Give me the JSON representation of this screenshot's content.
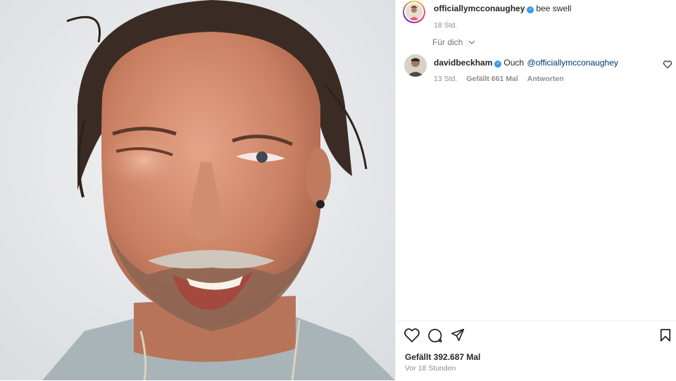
{
  "post": {
    "author": "officiallymcconaughey",
    "caption": "bee swell",
    "time": "18 Std."
  },
  "filter": {
    "label": "Für dich",
    "icon": "chevron-down-icon"
  },
  "comment": {
    "author": "davidbeckham",
    "text": "Ouch",
    "mention": "@officiallymcconaughey",
    "time": "13 Std.",
    "likes": "Gefällt 661 Mal",
    "reply": "Antworten"
  },
  "footer": {
    "likes": "Gefällt 392.687 Mal",
    "ago": "Vor 18 Stunden"
  },
  "colors": {
    "verified": "#3897f0",
    "mention": "#00376b",
    "muted": "#8e8e8e"
  }
}
